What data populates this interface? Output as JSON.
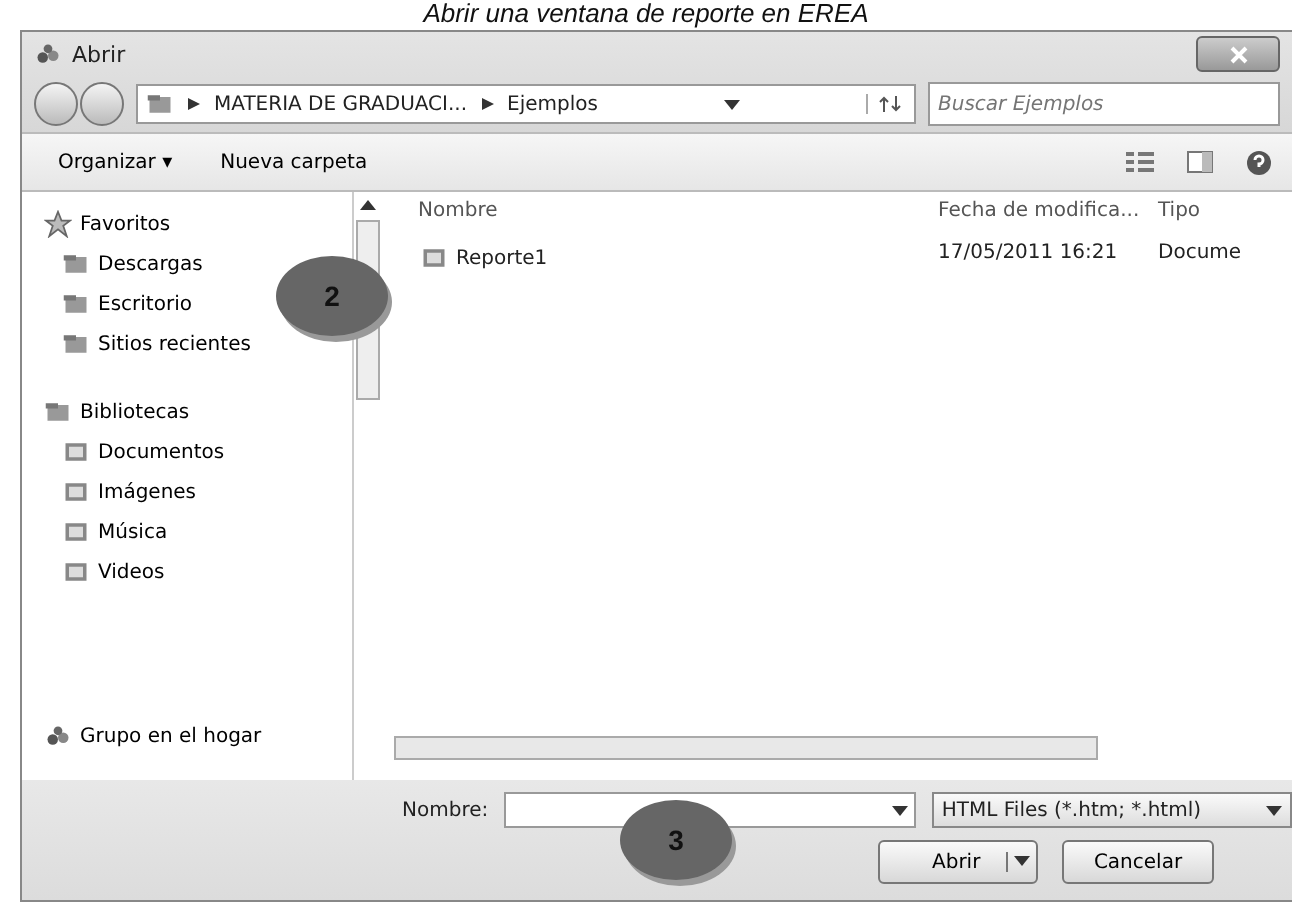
{
  "caption": "Abrir una ventana de reporte en EREA",
  "window": {
    "title": "Abrir"
  },
  "address": {
    "path": [
      "MATERIA DE GRADUACI...",
      "Ejemplos"
    ]
  },
  "search": {
    "placeholder": "Buscar Ejemplos"
  },
  "toolbar": {
    "buttons": [
      "Organizar ▾",
      "Nueva carpeta"
    ]
  },
  "sidebar": {
    "groups": [
      {
        "label": "Favoritos",
        "children": [
          {
            "label": "Descargas"
          },
          {
            "label": "Escritorio"
          },
          {
            "label": "Sitios recientes"
          }
        ]
      },
      {
        "label": "Bibliotecas",
        "children": [
          {
            "label": "Documentos"
          },
          {
            "label": "Imágenes"
          },
          {
            "label": "Música"
          },
          {
            "label": "Videos"
          }
        ]
      },
      {
        "label": "Grupo en el hogar"
      }
    ]
  },
  "table": {
    "columns": [
      "Nombre",
      "Fecha de modifica...",
      "Tipo"
    ],
    "rows": [
      [
        "Reporte1",
        "17/05/2011 16:21",
        "Docume"
      ]
    ]
  },
  "filename": {
    "label": "Nombre:"
  },
  "filetype": {
    "value": "HTML Files (*.htm; *.html)"
  },
  "buttons": [
    "Abrir",
    "Cancelar"
  ],
  "callouts": [
    {
      "number": "2"
    },
    {
      "number": "3"
    }
  ]
}
